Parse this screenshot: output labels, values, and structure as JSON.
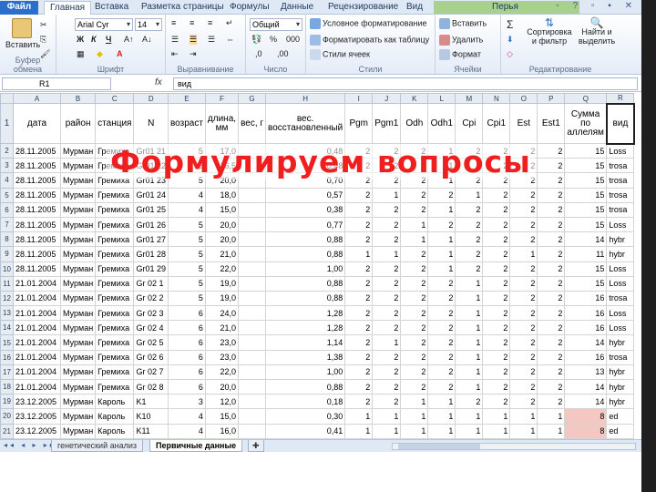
{
  "ribbon": {
    "tabs": [
      {
        "label": "Файл"
      },
      {
        "label": "Главная"
      },
      {
        "label": "Вставка"
      },
      {
        "label": "Разметка страницы"
      },
      {
        "label": "Формулы"
      },
      {
        "label": "Данные"
      },
      {
        "label": "Рецензирование"
      },
      {
        "label": "Вид"
      },
      {
        "label": "Перья"
      }
    ],
    "clipboard": {
      "paste": "Вставить",
      "label": "Буфер обмена"
    },
    "font": {
      "name": "Arial Cyr",
      "size": "14",
      "label": "Шрифт"
    },
    "alignment": {
      "label": "Выравнивание"
    },
    "number": {
      "format": "Общий",
      "label": "Число"
    },
    "styles": {
      "conditional": "Условное форматирование",
      "as_table": "Форматировать как таблицу",
      "cell_styles": "Стили ячеек",
      "label": "Стили"
    },
    "cells": {
      "insert": "Вставить",
      "delete": "Удалить",
      "format": "Формат",
      "label": "Ячейки"
    },
    "editing": {
      "sort": "Сортировка и фильтр",
      "find": "Найти и выделить",
      "label": "Редактирование"
    }
  },
  "formula_bar": {
    "name_box": "R1",
    "fx": "fx",
    "content": "вид"
  },
  "columns": [
    "A",
    "B",
    "C",
    "D",
    "E",
    "F",
    "G",
    "H",
    "I",
    "J",
    "K",
    "L",
    "M",
    "N",
    "O",
    "P",
    "Q",
    "R"
  ],
  "header_row": [
    "дата",
    "район",
    "станция",
    "N",
    "возраст",
    "длина, мм",
    "вес, г",
    "вес. восстановленный",
    "Pgm",
    "Pgm1",
    "Odh",
    "Odh1",
    "Cpi",
    "Cpi1",
    "Est",
    "Est1",
    "Сумма по аллелям",
    "вид"
  ],
  "rows": [
    {
      "n": "2",
      "cells": [
        "28.11.2005",
        "Мурман",
        "Гремиха",
        "Gr01 21",
        "5",
        "17,0",
        "",
        "0,48",
        "2",
        "2",
        "2",
        "1",
        "2",
        "2",
        "2",
        "2",
        "15",
        "Loss"
      ]
    },
    {
      "n": "3",
      "cells": [
        "28.11.2005",
        "Мурман",
        "Гремиха",
        "Gr01 22",
        "5",
        "16,5",
        "",
        "0,48",
        "2",
        "2",
        "2",
        "1",
        "2",
        "2",
        "2",
        "2",
        "15",
        "trosa"
      ]
    },
    {
      "n": "4",
      "cells": [
        "28.11.2005",
        "Мурман",
        "Гремиха",
        "Gr01 23",
        "5",
        "20,0",
        "",
        "0,70",
        "2",
        "2",
        "2",
        "1",
        "2",
        "2",
        "2",
        "2",
        "15",
        "trosa"
      ]
    },
    {
      "n": "5",
      "cells": [
        "28.11.2005",
        "Мурман",
        "Гремиха",
        "Gr01 24",
        "4",
        "18,0",
        "",
        "0,57",
        "2",
        "1",
        "2",
        "2",
        "1",
        "2",
        "2",
        "2",
        "15",
        "trosa"
      ]
    },
    {
      "n": "6",
      "cells": [
        "28.11.2005",
        "Мурман",
        "Гремиха",
        "Gr01 25",
        "4",
        "15,0",
        "",
        "0,38",
        "2",
        "2",
        "2",
        "1",
        "2",
        "2",
        "2",
        "2",
        "15",
        "trosa"
      ]
    },
    {
      "n": "7",
      "cells": [
        "28.11.2005",
        "Мурман",
        "Гремиха",
        "Gr01 26",
        "5",
        "20,0",
        "",
        "0,77",
        "2",
        "2",
        "1",
        "2",
        "2",
        "2",
        "2",
        "2",
        "15",
        "Loss"
      ]
    },
    {
      "n": "8",
      "cells": [
        "28.11.2005",
        "Мурман",
        "Гремиха",
        "Gr01 27",
        "5",
        "20,0",
        "",
        "0,88",
        "2",
        "2",
        "1",
        "1",
        "2",
        "2",
        "2",
        "2",
        "14",
        "hybr"
      ]
    },
    {
      "n": "9",
      "cells": [
        "28.11.2005",
        "Мурман",
        "Гремиха",
        "Gr01 28",
        "5",
        "21,0",
        "",
        "0,88",
        "1",
        "1",
        "2",
        "1",
        "2",
        "2",
        "1",
        "2",
        "11",
        "hybr"
      ]
    },
    {
      "n": "10",
      "cells": [
        "28.11.2005",
        "Мурман",
        "Гремиха",
        "Gr01 29",
        "5",
        "22,0",
        "",
        "1,00",
        "2",
        "2",
        "2",
        "1",
        "2",
        "2",
        "2",
        "2",
        "15",
        "Loss"
      ]
    },
    {
      "n": "11",
      "cells": [
        "21.01.2004",
        "Мурман",
        "Гремиха",
        "Gr 02 1",
        "5",
        "19,0",
        "",
        "0,88",
        "2",
        "2",
        "2",
        "2",
        "1",
        "2",
        "2",
        "2",
        "15",
        "Loss"
      ]
    },
    {
      "n": "12",
      "cells": [
        "21.01.2004",
        "Мурман",
        "Гремиха",
        "Gr 02 2",
        "5",
        "19,0",
        "",
        "0,88",
        "2",
        "2",
        "2",
        "2",
        "1",
        "2",
        "2",
        "2",
        "16",
        "trosa"
      ]
    },
    {
      "n": "13",
      "cells": [
        "21.01.2004",
        "Мурман",
        "Гремиха",
        "Gr 02 3",
        "6",
        "24,0",
        "",
        "1,28",
        "2",
        "2",
        "2",
        "2",
        "1",
        "2",
        "2",
        "2",
        "16",
        "Loss"
      ]
    },
    {
      "n": "14",
      "cells": [
        "21.01.2004",
        "Мурман",
        "Гремиха",
        "Gr 02 4",
        "6",
        "21,0",
        "",
        "1,28",
        "2",
        "2",
        "2",
        "2",
        "1",
        "2",
        "2",
        "2",
        "16",
        "Loss"
      ]
    },
    {
      "n": "15",
      "cells": [
        "21.01.2004",
        "Мурман",
        "Гремиха",
        "Gr 02 5",
        "6",
        "23,0",
        "",
        "1,14",
        "2",
        "1",
        "2",
        "2",
        "1",
        "2",
        "2",
        "2",
        "14",
        "hybr"
      ]
    },
    {
      "n": "16",
      "cells": [
        "21.01.2004",
        "Мурман",
        "Гремиха",
        "Gr 02 6",
        "6",
        "23,0",
        "",
        "1,38",
        "2",
        "2",
        "2",
        "2",
        "1",
        "2",
        "2",
        "2",
        "16",
        "trosa"
      ]
    },
    {
      "n": "17",
      "cells": [
        "21.01.2004",
        "Мурман",
        "Гремиха",
        "Gr 02 7",
        "6",
        "22,0",
        "",
        "1,00",
        "2",
        "2",
        "2",
        "2",
        "1",
        "2",
        "2",
        "2",
        "13",
        "hybr"
      ]
    },
    {
      "n": "18",
      "cells": [
        "21.01.2004",
        "Мурман",
        "Гремиха",
        "Gr 02 8",
        "6",
        "20,0",
        "",
        "0,88",
        "2",
        "2",
        "2",
        "2",
        "1",
        "2",
        "2",
        "2",
        "14",
        "hybr"
      ]
    },
    {
      "n": "19",
      "cells": [
        "23.12.2005",
        "Мурман",
        "Кароль",
        "K1",
        "3",
        "12,0",
        "",
        "0,18",
        "2",
        "2",
        "1",
        "1",
        "2",
        "2",
        "2",
        "2",
        "14",
        "hybr"
      ]
    },
    {
      "n": "20",
      "cells": [
        "23.12.2005",
        "Мурман",
        "Кароль",
        "K10",
        "4",
        "15,0",
        "",
        "0,30",
        "1",
        "1",
        "1",
        "1",
        "1",
        "1",
        "1",
        "1",
        "8",
        "ed"
      ]
    },
    {
      "n": "21",
      "cells": [
        "23.12.2005",
        "Мурман",
        "Кароль",
        "K11",
        "4",
        "16,0",
        "",
        "0,41",
        "1",
        "1",
        "1",
        "1",
        "1",
        "1",
        "1",
        "1",
        "8",
        "ed"
      ]
    }
  ],
  "sheets": [
    {
      "label": "генетический анализ"
    },
    {
      "label": "Первичные данные"
    }
  ],
  "overlay_title": "Формулируем вопросы",
  "colors": {
    "overlay": "#ef1f1f",
    "highlight": "#f4c7c3",
    "file_tab": "#2a6fc9"
  }
}
